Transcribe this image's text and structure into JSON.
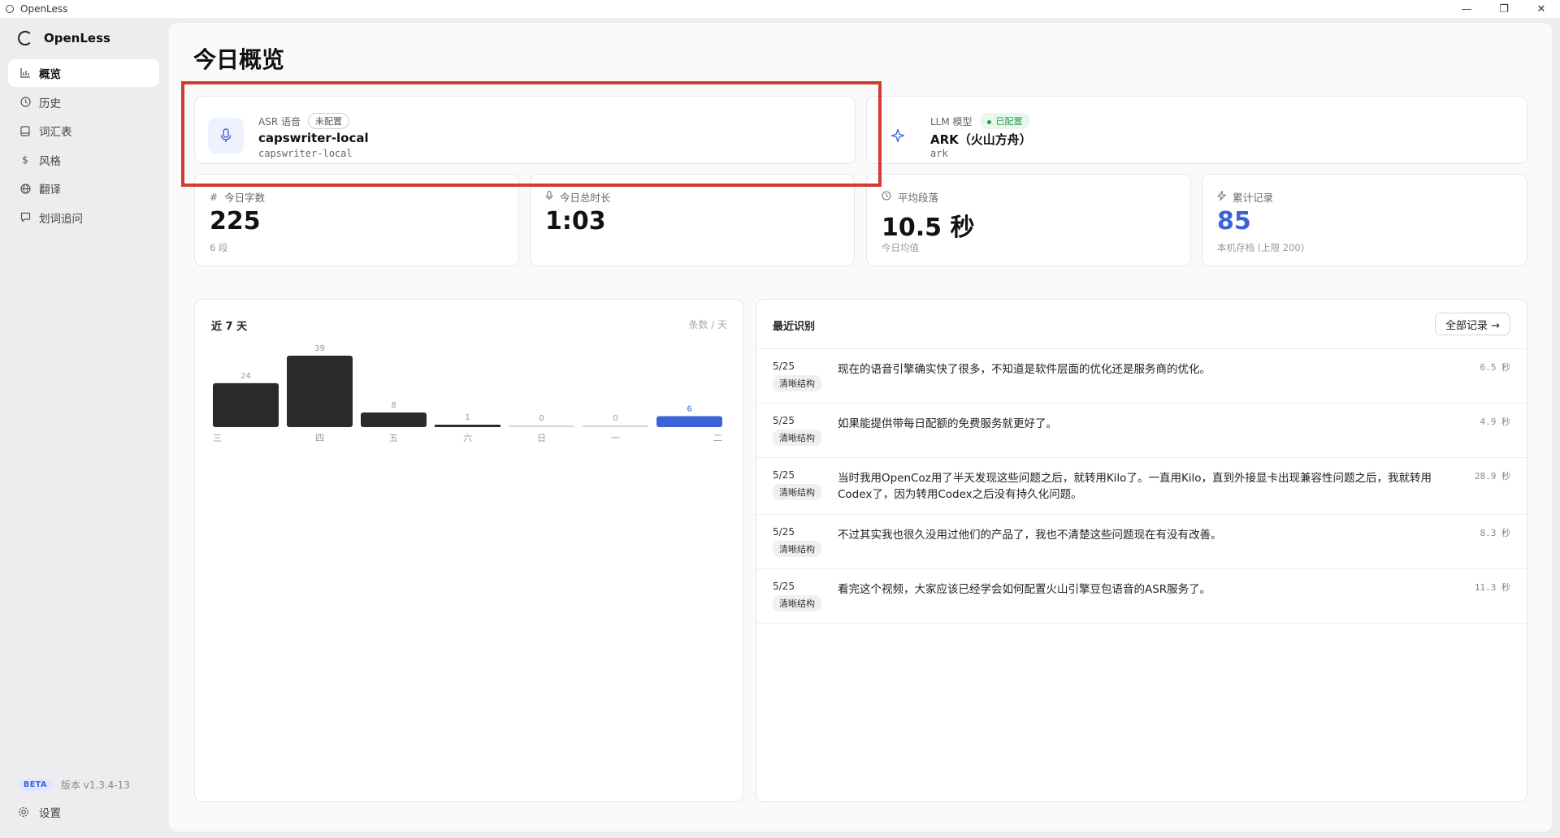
{
  "window": {
    "title": "OpenLess",
    "minimize": "—",
    "restore": "❐",
    "close": "✕"
  },
  "sidebar": {
    "brand": "OpenLess",
    "items": [
      {
        "label": "概览",
        "icon": "bar-chart-icon",
        "active": true
      },
      {
        "label": "历史",
        "icon": "clock-icon"
      },
      {
        "label": "词汇表",
        "icon": "book-icon"
      },
      {
        "label": "风格",
        "icon": "dollar-icon"
      },
      {
        "label": "翻译",
        "icon": "globe-icon"
      },
      {
        "label": "划词追问",
        "icon": "chat-icon"
      }
    ],
    "beta": "BETA",
    "version": "版本 v1.3.4-13",
    "settings": "设置"
  },
  "page": {
    "title": "今日概览"
  },
  "asr": {
    "label": "ASR 语音",
    "status": "未配置",
    "name": "capswriter-local",
    "sub": "capswriter-local"
  },
  "llm": {
    "label": "LLM 模型",
    "status": "已配置",
    "name": "ARK（火山方舟）",
    "sub": "ark"
  },
  "stats": [
    {
      "label": "今日字数",
      "icon": "hash-icon",
      "value": "225",
      "foot": "6 段"
    },
    {
      "label": "今日总时长",
      "icon": "mic-icon",
      "value": "1:03",
      "foot": ""
    },
    {
      "label": "平均段落",
      "icon": "clock-icon",
      "value": "10.5 秒",
      "foot": "今日均值"
    },
    {
      "label": "累计记录",
      "icon": "bolt-icon",
      "value": "85",
      "foot": "本机存档 (上限 200)"
    }
  ],
  "chart": {
    "title": "近 7 天",
    "unit": "条数 / 天"
  },
  "chart_data": {
    "type": "bar",
    "categories": [
      "三",
      "四",
      "五",
      "六",
      "日",
      "一",
      "二"
    ],
    "values": [
      24,
      39,
      8,
      1,
      0,
      0,
      6
    ],
    "highlight_index": 6,
    "colors": {
      "default": "#2a2a2a",
      "highlight": "#3b63d8",
      "empty": "#d8d8dc"
    },
    "ylim": [
      0,
      39
    ]
  },
  "recent": {
    "title": "最近识别",
    "all_button": "全部记录 →",
    "items": [
      {
        "date": "5/25",
        "tag": "清晰结构",
        "text": "现在的语音引擎确实快了很多，不知道是软件层面的优化还是服务商的优化。",
        "dur": "6.5 秒"
      },
      {
        "date": "5/25",
        "tag": "清晰结构",
        "text": "如果能提供带每日配额的免费服务就更好了。",
        "dur": "4.9 秒"
      },
      {
        "date": "5/25",
        "tag": "清晰结构",
        "text": "当时我用OpenCoz用了半天发现这些问题之后，就转用Kilo了。一直用Kilo，直到外接显卡出现兼容性问题之后，我就转用Codex了，因为转用Codex之后没有持久化问题。",
        "dur": "28.9 秒"
      },
      {
        "date": "5/25",
        "tag": "清晰结构",
        "text": "不过其实我也很久没用过他们的产品了，我也不清楚这些问题现在有没有改善。",
        "dur": "8.3 秒"
      },
      {
        "date": "5/25",
        "tag": "清晰结构",
        "text": "看完这个视频，大家应该已经学会如何配置火山引擎豆包语音的ASR服务了。",
        "dur": "11.3 秒"
      }
    ]
  }
}
